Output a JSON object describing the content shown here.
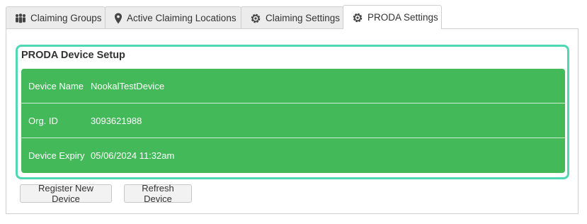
{
  "tabs": [
    {
      "label": "Claiming Groups",
      "icon": "group-icon"
    },
    {
      "label": "Active Claiming Locations",
      "icon": "location-pin-icon"
    },
    {
      "label": "Claiming Settings",
      "icon": "gear-icon"
    },
    {
      "label": "PRODA Settings",
      "icon": "gear-icon",
      "active": true
    }
  ],
  "setup": {
    "title": "PRODA Device Setup",
    "rows": [
      {
        "key": "Device Name",
        "value": "NookalTestDevice"
      },
      {
        "key": "Org. ID",
        "value": "3093621988"
      },
      {
        "key": "Device Expiry",
        "value": "05/06/2024 11:32am"
      }
    ]
  },
  "buttons": {
    "register": "Register New Device",
    "refresh": "Refresh Device"
  },
  "colors": {
    "panel_green": "#43b95a",
    "highlight_border": "#4fd8b4"
  }
}
